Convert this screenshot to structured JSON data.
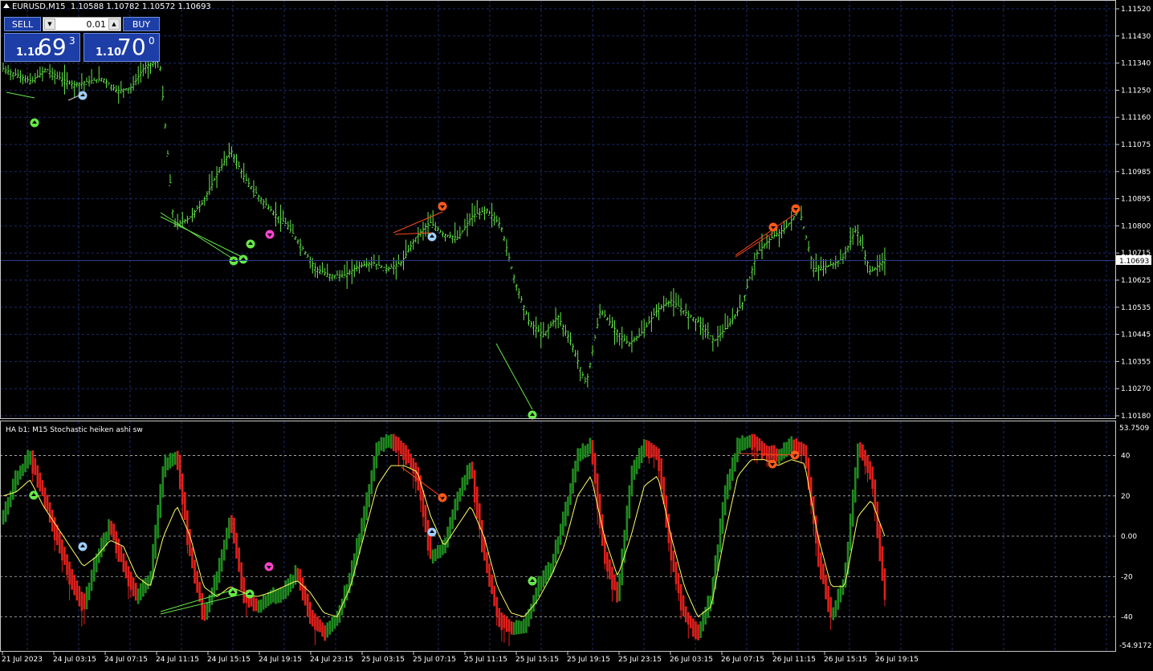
{
  "header": {
    "symbol": "EURUSD,M15",
    "ohlc": "1.10588 1.10782 1.10572 1.10693"
  },
  "trade_panel": {
    "sell_label": "SELL",
    "buy_label": "BUY",
    "lot_value": "0.01",
    "sell_price_prefix": "1.10",
    "sell_price_big": "69",
    "sell_price_sup": "3",
    "buy_price_prefix": "1.10",
    "buy_price_big": "70",
    "buy_price_sup": "0"
  },
  "price_axis_ticks": [
    "1.11520",
    "1.11430",
    "1.11340",
    "1.11250",
    "1.11160",
    "1.11075",
    "1.10985",
    "1.10895",
    "1.10800",
    "1.10715",
    "1.10625",
    "1.10535",
    "1.10445",
    "1.10355",
    "1.10270",
    "1.10180"
  ],
  "current_price_label": "1.10693",
  "indicator": {
    "title": "HA b1: M15 Stochastic heiken ashi sw",
    "axis_top": "53.7509",
    "axis_bottom": "-54.9172",
    "levels": [
      "40",
      "20",
      "0.00",
      "-20",
      "-40"
    ]
  },
  "time_labels": [
    "21 Jul 2023",
    "24 Jul 03:15",
    "24 Jul 07:15",
    "24 Jul 11:15",
    "24 Jul 15:15",
    "24 Jul 19:15",
    "24 Jul 23:15",
    "25 Jul 03:15",
    "25 Jul 07:15",
    "25 Jul 11:15",
    "25 Jul 15:15",
    "25 Jul 19:15",
    "25 Jul 23:15",
    "26 Jul 03:15",
    "26 Jul 07:15",
    "26 Jul 11:15",
    "26 Jul 15:15",
    "26 Jul 19:15"
  ],
  "colors": {
    "background": "#000000",
    "grid": "#1c2a6e",
    "price_bars": "#66e84a",
    "ha_bull": "#1f8a1f",
    "ha_bear": "#e0201c",
    "signal_line": "#ffff66",
    "buy_arrow": "#9fd0ff",
    "sell_arrow": "#ff5a1a",
    "panel_blue": "#1d3ea6"
  },
  "chart_data": [
    {
      "type": "ohlc",
      "title": "EURUSD,M15",
      "ylim": [
        1.1018,
        1.1152
      ],
      "x_start": "21 Jul 2023",
      "x_end": "26 Jul 19:15",
      "series": [
        {
          "name": "EURUSD",
          "close_approx": [
            1.113,
            1.1128,
            1.1126,
            1.113,
            1.1127,
            1.1125,
            1.1126,
            1.1127,
            1.1123,
            1.1124,
            1.1131,
            1.1133,
            1.108,
            1.1082,
            1.1087,
            1.1096,
            1.1104,
            1.1095,
            1.1089,
            1.1084,
            1.108,
            1.1073,
            1.1066,
            1.1064,
            1.1064,
            1.1067,
            1.1068,
            1.1066,
            1.1068,
            1.1076,
            1.1081,
            1.1077,
            1.1076,
            1.1083,
            1.1085,
            1.108,
            1.1062,
            1.1049,
            1.1045,
            1.1051,
            1.1042,
            1.1029,
            1.1053,
            1.1047,
            1.1042,
            1.1046,
            1.1053,
            1.1056,
            1.1052,
            1.1049,
            1.1043,
            1.1048,
            1.1055,
            1.1071,
            1.1076,
            1.1079,
            1.1085,
            1.1066,
            1.1067,
            1.1069,
            1.1079,
            1.1065,
            1.1069
          ]
        }
      ]
    },
    {
      "type": "bar",
      "title": "HA b1: M15 Stochastic heiken ashi sw",
      "ylim": [
        -54.9172,
        53.7509
      ],
      "levels": [
        40,
        20,
        0,
        -20,
        -40
      ],
      "series": [
        {
          "name": "stochastic",
          "values": [
            10,
            30,
            40,
            20,
            0,
            -20,
            -35,
            -10,
            5,
            -15,
            -30,
            -20,
            35,
            40,
            -10,
            -40,
            -20,
            10,
            -30,
            -35,
            -30,
            -28,
            -18,
            -40,
            -48,
            -40,
            -20,
            10,
            45,
            48,
            42,
            30,
            -10,
            -5,
            20,
            35,
            -10,
            -40,
            -46,
            -45,
            -25,
            -15,
            10,
            40,
            45,
            -10,
            -30,
            30,
            45,
            40,
            -10,
            -40,
            -48,
            -30,
            20,
            45,
            48,
            42,
            40,
            45,
            42,
            -10,
            -40,
            -20,
            45,
            30,
            -30
          ]
        },
        {
          "name": "signal",
          "values": [
            20,
            22,
            28,
            15,
            5,
            -5,
            -15,
            -10,
            -2,
            -5,
            -20,
            -25,
            0,
            15,
            0,
            -25,
            -30,
            -25,
            -28,
            -30,
            -28,
            -25,
            -22,
            -28,
            -38,
            -40,
            -25,
            0,
            25,
            35,
            35,
            32,
            10,
            -5,
            5,
            15,
            0,
            -25,
            -38,
            -40,
            -32,
            -20,
            -5,
            20,
            30,
            0,
            -20,
            0,
            25,
            30,
            0,
            -25,
            -40,
            -35,
            0,
            30,
            38,
            38,
            35,
            38,
            36,
            0,
            -25,
            -25,
            10,
            18,
            0
          ]
        }
      ]
    }
  ]
}
